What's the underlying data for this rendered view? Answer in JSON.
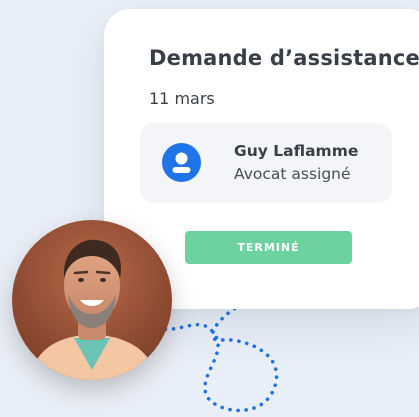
{
  "card": {
    "title": "Demande d’assistance",
    "date": "11 mars",
    "assignee": {
      "name": "Guy Laflamme",
      "role": "Avocat assigné",
      "icon": "user-icon"
    },
    "status_button": "TERMINÉ"
  },
  "colors": {
    "background": "#e9eff8",
    "card": "#ffffff",
    "accent_blue": "#1f74e8",
    "button_green": "#6cd2a0",
    "dotted_line": "#1f74e8",
    "text_dark": "#3a3f47"
  }
}
